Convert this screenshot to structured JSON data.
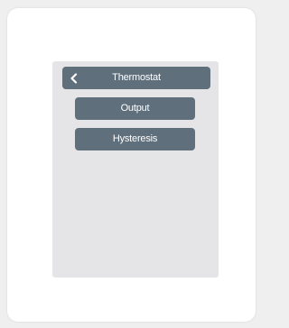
{
  "header": {
    "title": "Thermostat",
    "back_icon": "chevron-left-icon"
  },
  "menu": {
    "items": [
      {
        "label": "Output"
      },
      {
        "label": "Hysteresis"
      }
    ]
  },
  "colors": {
    "button_bg": "#5f6f7c",
    "panel_bg": "#e5e5e7",
    "text": "#ffffff"
  }
}
